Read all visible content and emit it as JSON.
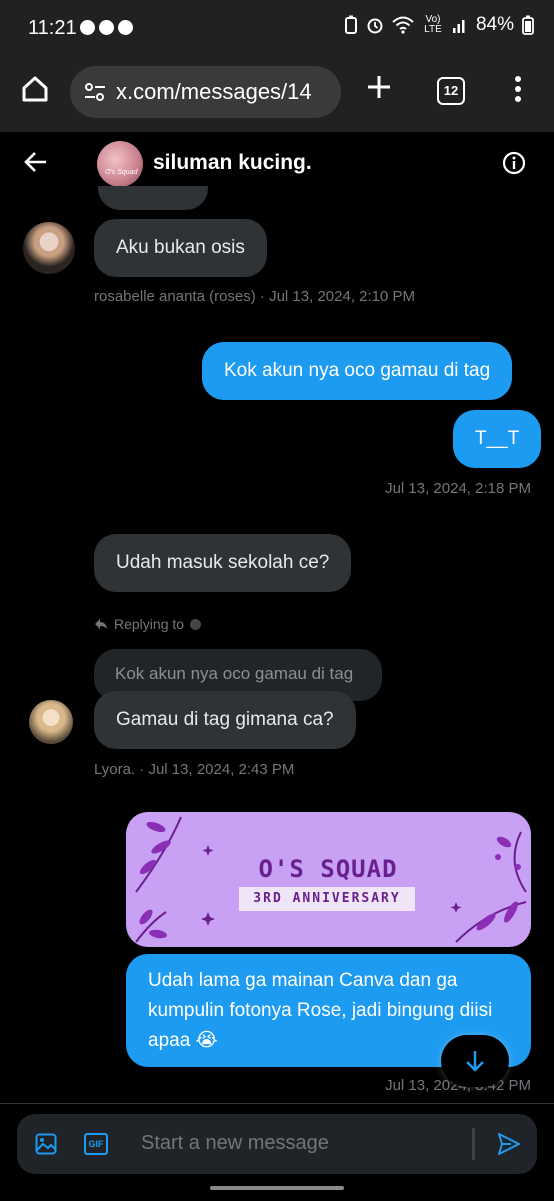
{
  "status_bar": {
    "time": "11:21",
    "battery": "84%",
    "network": "Vo) LTE"
  },
  "browser": {
    "url": "x.com/messages/14",
    "tab_count": "12"
  },
  "chat_header": {
    "title": "siluman kucing.",
    "avatar_caption": "O's Squad"
  },
  "messages": {
    "m1": {
      "text": "Aku bukan osis",
      "meta": "rosabelle ananta (roses) · Jul 13, 2024, 2:10 PM"
    },
    "m2": {
      "text": "Kok akun nya oco gamau di tag"
    },
    "m3": {
      "text": "T__T",
      "meta": "Jul 13, 2024, 2:18 PM"
    },
    "m4": {
      "text": "Udah masuk sekolah ce?"
    },
    "m5": {
      "replying_label": "Replying to",
      "quoted": "Kok akun nya oco gamau di tag",
      "text": "Gamau di tag gimana ca?",
      "meta": "Lyora. · Jul 13, 2024, 2:43 PM"
    },
    "m6": {
      "card_title": "O'S SQUAD",
      "card_subtitle": "3RD ANNIVERSARY",
      "text": "Udah lama ga mainan Canva dan ga kumpulin fotonya Rose, jadi bingung diisi apaa 😭",
      "meta": "Jul 13, 2024, 8:42 PM"
    }
  },
  "composer": {
    "placeholder": "Start a new message",
    "gif_label": "GIF"
  },
  "colors": {
    "outgoing": "#1d9bf0",
    "incoming": "#2f3336",
    "card": "#c9a1f4"
  }
}
